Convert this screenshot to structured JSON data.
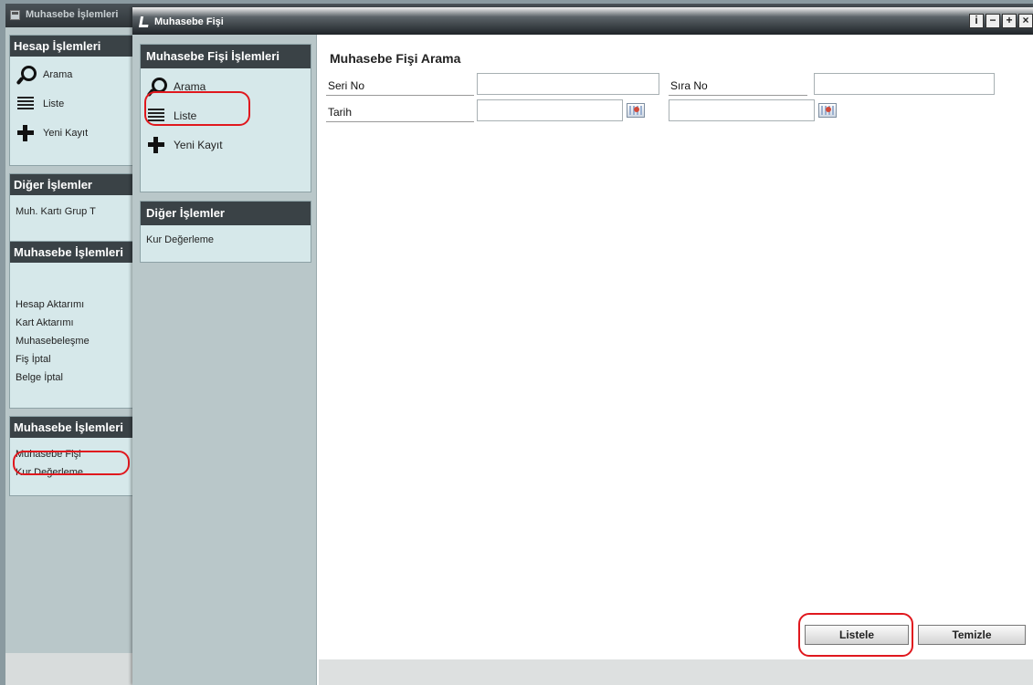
{
  "background_window": {
    "title": "Muhasebe İşlemleri",
    "panels": [
      {
        "heading": "Hesap İşlemleri",
        "items": [
          {
            "label": "Arama",
            "icon": "search-icon"
          },
          {
            "label": "Liste",
            "icon": "list-icon"
          },
          {
            "label": "Yeni Kayıt",
            "icon": "new-record-icon"
          }
        ]
      },
      {
        "heading": "Diğer İşlemler",
        "links": [
          "Muh. Kartı Grup T"
        ]
      },
      {
        "heading": "Muhasebe İşlemleri",
        "links": [
          "Hesap Aktarımı",
          "Kart Aktarımı",
          "Muhasebeleşme",
          "Fiş İptal",
          "Belge İptal"
        ]
      },
      {
        "heading": "Muhasebe İşlemleri",
        "links": [
          "Muhasebe Fişi",
          "Kur Değerleme"
        ]
      }
    ]
  },
  "window": {
    "title": "Muhasebe Fişi",
    "controls": [
      "i",
      "−",
      "+",
      "×"
    ]
  },
  "sidebar": {
    "panels": [
      {
        "heading": "Muhasebe Fişi İşlemleri",
        "items": [
          {
            "label": "Arama",
            "icon": "search-icon"
          },
          {
            "label": "Liste",
            "icon": "list-icon"
          },
          {
            "label": "Yeni Kayıt",
            "icon": "new-record-icon"
          }
        ]
      },
      {
        "heading": "Diğer İşlemler",
        "links": [
          "Kur Değerleme"
        ]
      }
    ]
  },
  "search_form": {
    "title": "Muhasebe Fişi Arama",
    "seri_no": {
      "label": "Seri No",
      "value": ""
    },
    "sira_no": {
      "label": "Sıra No",
      "value": ""
    },
    "tarih": {
      "label": "Tarih",
      "start": "",
      "end": ""
    }
  },
  "buttons": {
    "list": "Listele",
    "clear": "Temizle"
  },
  "colors": {
    "annotation": "#e0181e",
    "panel_header": "#3a4246",
    "panel_bg": "#d6e8ea"
  }
}
